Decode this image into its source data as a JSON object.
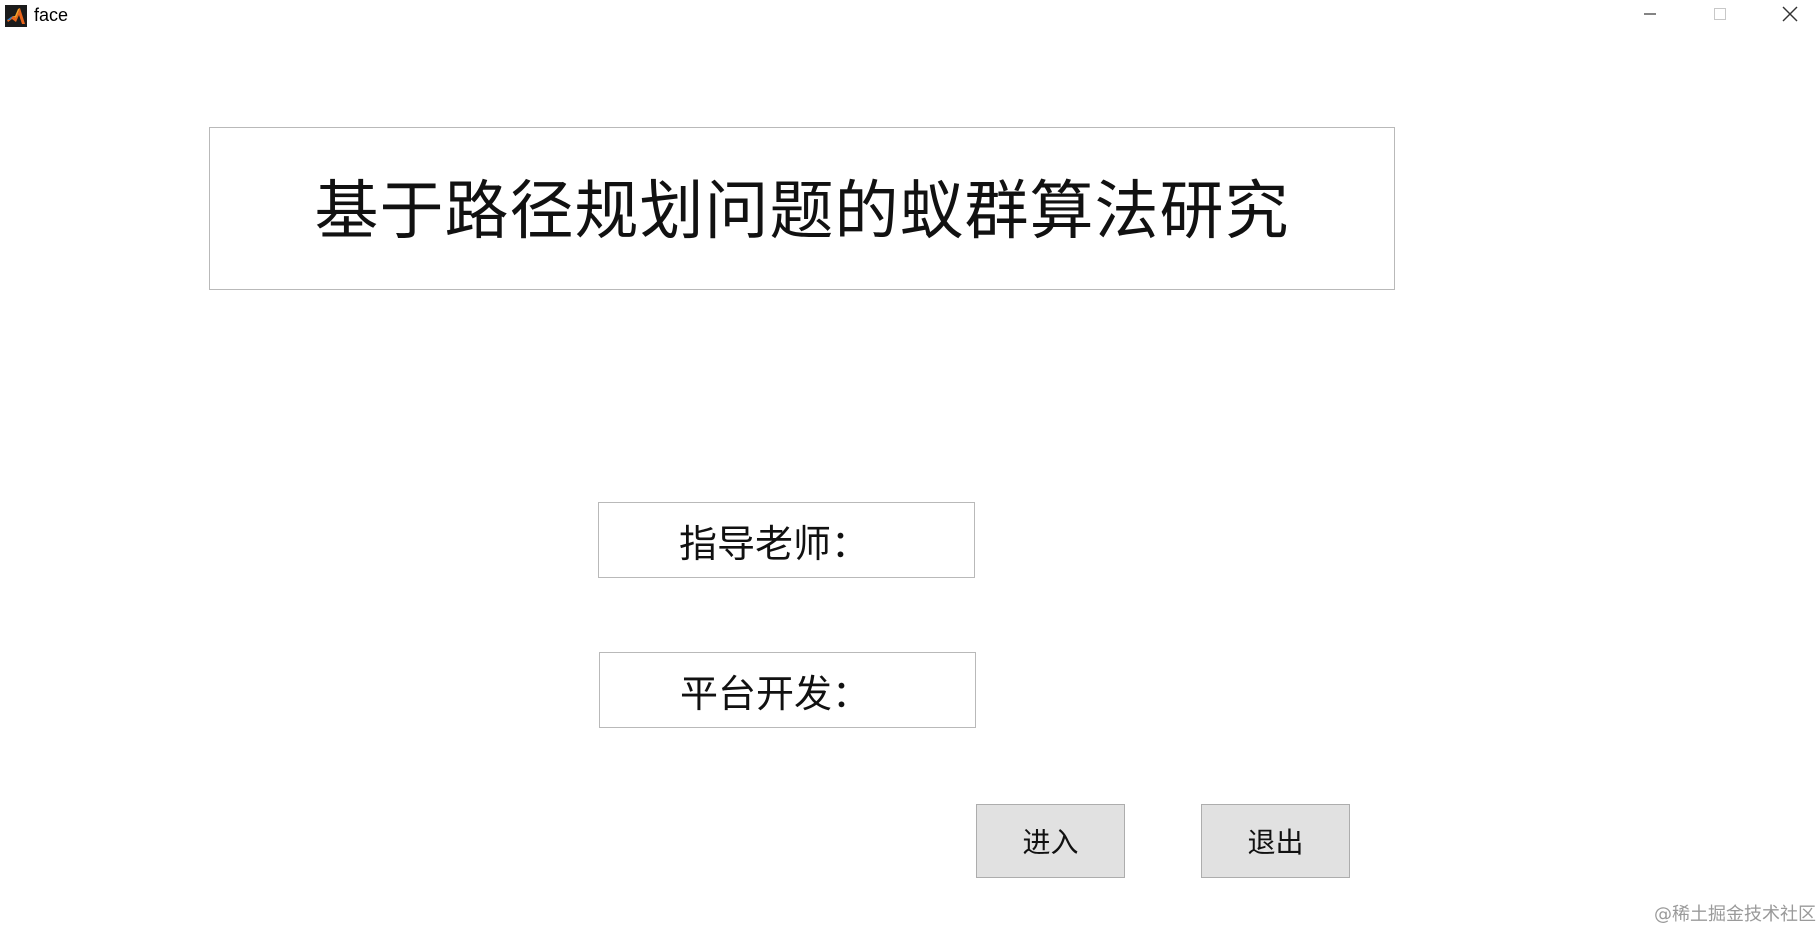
{
  "window": {
    "title": "face",
    "app_icon": "matlab-icon",
    "controls": {
      "minimize_icon": "minimize-icon",
      "maximize_icon": "maximize-icon",
      "close_icon": "close-icon"
    }
  },
  "main": {
    "heading": "基于路径规划问题的蚁群算法研究",
    "advisor_label": "指导老师：",
    "platform_label": "平台开发："
  },
  "buttons": {
    "enter_label": "进入",
    "exit_label": "退出"
  },
  "watermark": "@稀土掘金技术社区",
  "colors": {
    "background": "#ffffff",
    "button_bg": "#e1e1e1",
    "border": "#b9b9b9",
    "watermark": "#9a9a9a"
  }
}
